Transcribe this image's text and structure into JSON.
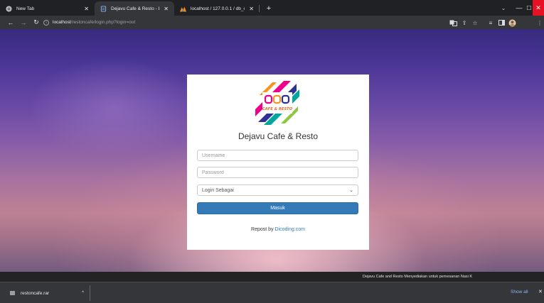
{
  "browser": {
    "tabs": [
      {
        "title": "New Tab",
        "icon": "chrome-icon",
        "active": false
      },
      {
        "title": "Dejavu Cafe & Resto - Login",
        "icon": "page-icon",
        "active": true
      },
      {
        "title": "localhost / 127.0.0.1 / db_cafe / t",
        "icon": "phpmyadmin-icon",
        "active": false
      }
    ],
    "new_tab_glyph": "+",
    "address": {
      "host": "localhost",
      "path": "/restoncafe/login.php?login=out"
    }
  },
  "login": {
    "brand_name": "Dejavu Cafe & Resto",
    "logo_text": "CAFE & RESTO",
    "username_placeholder": "Username",
    "password_placeholder": "Password",
    "role_select": "Login Sebagai",
    "submit_label": "Masuk",
    "credit_prefix": "Repost by ",
    "credit_link": "Dicoding.com"
  },
  "footer": {
    "text": "Dejavu Cafe and Resto Menyediakan untuk pemesanan Nasi K"
  },
  "downloads": {
    "file_name": "restoncafe.rar",
    "show_all_label": "Show all"
  },
  "colors": {
    "primary_button": "#337ab7",
    "window_close": "#e81123"
  }
}
